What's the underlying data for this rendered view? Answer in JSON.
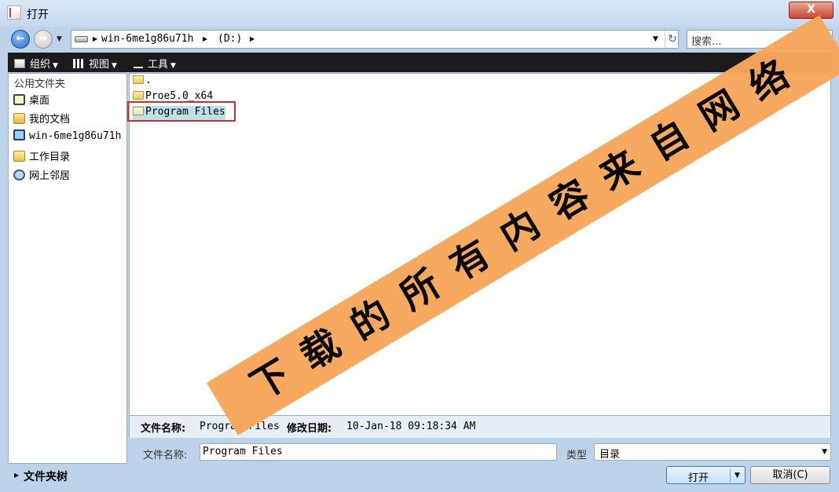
{
  "window": {
    "title": "打开",
    "close_label": "X"
  },
  "navbar": {
    "back_label": "←",
    "forward_label": "→",
    "crumbs": [
      "win-6me1g86u71h",
      "(D:)"
    ],
    "search_placeholder": "搜索..."
  },
  "toolbar": {
    "organize": "组织",
    "view": "视图",
    "tools": "工具"
  },
  "sidebar": {
    "header": "公用文件夹",
    "items": [
      {
        "label": "桌面",
        "icon": "desktop-icon"
      },
      {
        "label": "我的文档",
        "icon": "documents-icon"
      },
      {
        "label": "win-6me1g86u71h",
        "icon": "computer-icon"
      },
      {
        "label": "工作目录",
        "icon": "working-dir-icon"
      },
      {
        "label": "网上邻居",
        "icon": "network-icon"
      }
    ],
    "tree_label": "文件夹树"
  },
  "files": [
    {
      "name": "."
    },
    {
      "name": "Proe5.0_x64"
    },
    {
      "name": "Program Files",
      "selected": true
    }
  ],
  "info": {
    "name_label": "文件名称:",
    "name_value": "Program Files",
    "date_label": "修改日期:",
    "date_value": "10-Jan-18 09:18:34 AM"
  },
  "form": {
    "filename_label": "文件名称:",
    "filename_value": "Program Files",
    "type_label": "类型",
    "type_value": "目录"
  },
  "buttons": {
    "open": "打开",
    "cancel": "取消(C)"
  },
  "watermark": {
    "text": "下载的所有内容来自网络",
    "color": "#f6a75a"
  },
  "colors": {
    "selection": "#bde0ea",
    "highlight_border": "#d22b2b"
  }
}
